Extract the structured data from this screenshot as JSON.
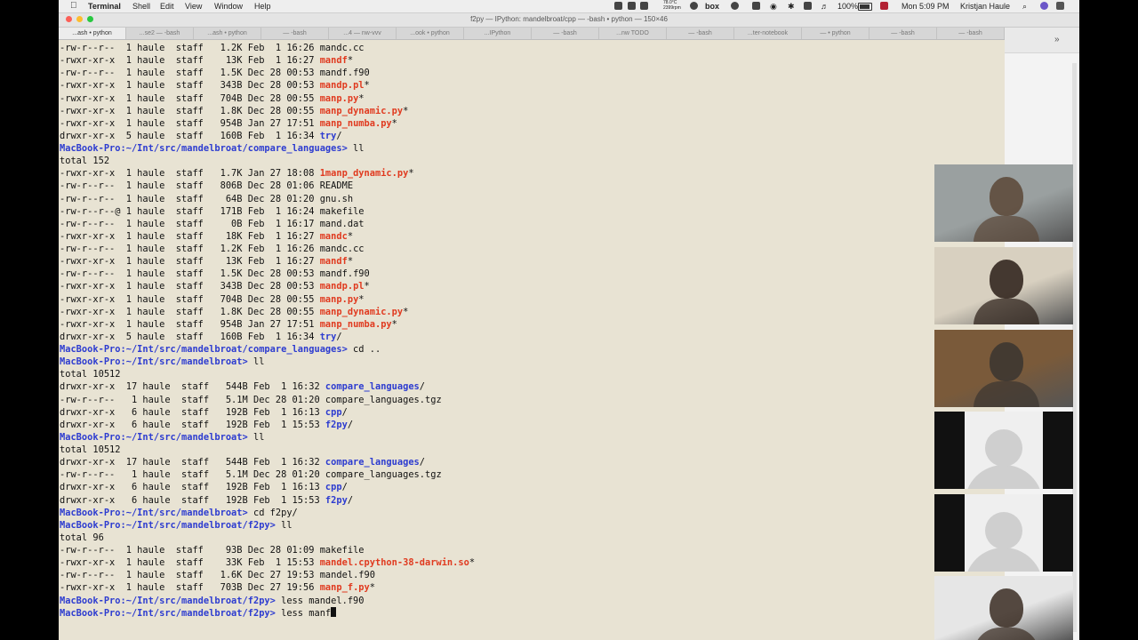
{
  "menubar": {
    "app_name": "Terminal",
    "menus": [
      "Shell",
      "Edit",
      "View",
      "Window",
      "Help"
    ],
    "status": {
      "temp": "78.0°C",
      "rpm": "2399rpm",
      "box_label": "box",
      "battery": "100%",
      "clock": "Mon 5:09 PM",
      "user": "Kristjan Haule"
    }
  },
  "window": {
    "title": "f2py — IPython: mandelbroat/cpp — -bash • python — 150×46",
    "tabs": [
      "...ash • python",
      "...se2 — -bash",
      "...ash • python",
      "— -bash",
      "...4 — nw-vvv",
      "...ook • python",
      "...IPython",
      "— -bash",
      "...nw TODO",
      "— -bash",
      "...ter-notebook",
      "— • python",
      "— -bash",
      "— -bash"
    ]
  },
  "terminal": {
    "lines": [
      [
        {
          "t": "-rw-r--r--  1 haule  staff   1.2K Feb  1 16:26 "
        },
        {
          "t": "mandc.cc"
        }
      ],
      [
        {
          "t": "-rwxr-xr-x  1 haule  staff    13K Feb  1 16:27 "
        },
        {
          "t": "mandf",
          "c": "exe"
        },
        {
          "t": "*"
        }
      ],
      [
        {
          "t": "-rw-r--r--  1 haule  staff   1.5K Dec 28 00:53 "
        },
        {
          "t": "mandf.f90"
        }
      ],
      [
        {
          "t": "-rwxr-xr-x  1 haule  staff   343B Dec 28 00:53 "
        },
        {
          "t": "mandp.pl",
          "c": "exe"
        },
        {
          "t": "*"
        }
      ],
      [
        {
          "t": "-rwxr-xr-x  1 haule  staff   704B Dec 28 00:55 "
        },
        {
          "t": "manp.py",
          "c": "exe"
        },
        {
          "t": "*"
        }
      ],
      [
        {
          "t": "-rwxr-xr-x  1 haule  staff   1.8K Dec 28 00:55 "
        },
        {
          "t": "manp_dynamic.py",
          "c": "exe"
        },
        {
          "t": "*"
        }
      ],
      [
        {
          "t": "-rwxr-xr-x  1 haule  staff   954B Jan 27 17:51 "
        },
        {
          "t": "manp_numba.py",
          "c": "exe"
        },
        {
          "t": "*"
        }
      ],
      [
        {
          "t": "drwxr-xr-x  5 haule  staff   160B Feb  1 16:34 "
        },
        {
          "t": "try",
          "c": "dir"
        },
        {
          "t": "/"
        }
      ],
      [
        {
          "t": "MacBook-Pro:~/Int/src/mandelbroat/compare_languages>",
          "c": "prompt"
        },
        {
          "t": " ll"
        }
      ],
      [
        {
          "t": "total 152"
        }
      ],
      [
        {
          "t": "-rwxr-xr-x  1 haule  staff   1.7K Jan 27 18:08 "
        },
        {
          "t": "1manp_dynamic.py",
          "c": "exe"
        },
        {
          "t": "*"
        }
      ],
      [
        {
          "t": "-rw-r--r--  1 haule  staff   806B Dec 28 01:06 "
        },
        {
          "t": "README"
        }
      ],
      [
        {
          "t": "-rw-r--r--  1 haule  staff    64B Dec 28 01:20 "
        },
        {
          "t": "gnu.sh"
        }
      ],
      [
        {
          "t": "-rw-r--r--@ 1 haule  staff   171B Feb  1 16:24 "
        },
        {
          "t": "makefile"
        }
      ],
      [
        {
          "t": "-rw-r--r--  1 haule  staff     0B Feb  1 16:17 "
        },
        {
          "t": "mand.dat"
        }
      ],
      [
        {
          "t": "-rwxr-xr-x  1 haule  staff    18K Feb  1 16:27 "
        },
        {
          "t": "mandc",
          "c": "exe"
        },
        {
          "t": "*"
        }
      ],
      [
        {
          "t": "-rw-r--r--  1 haule  staff   1.2K Feb  1 16:26 "
        },
        {
          "t": "mandc.cc"
        }
      ],
      [
        {
          "t": "-rwxr-xr-x  1 haule  staff    13K Feb  1 16:27 "
        },
        {
          "t": "mandf",
          "c": "exe"
        },
        {
          "t": "*"
        }
      ],
      [
        {
          "t": "-rw-r--r--  1 haule  staff   1.5K Dec 28 00:53 "
        },
        {
          "t": "mandf.f90"
        }
      ],
      [
        {
          "t": "-rwxr-xr-x  1 haule  staff   343B Dec 28 00:53 "
        },
        {
          "t": "mandp.pl",
          "c": "exe"
        },
        {
          "t": "*"
        }
      ],
      [
        {
          "t": "-rwxr-xr-x  1 haule  staff   704B Dec 28 00:55 "
        },
        {
          "t": "manp.py",
          "c": "exe"
        },
        {
          "t": "*"
        }
      ],
      [
        {
          "t": "-rwxr-xr-x  1 haule  staff   1.8K Dec 28 00:55 "
        },
        {
          "t": "manp_dynamic.py",
          "c": "exe"
        },
        {
          "t": "*"
        }
      ],
      [
        {
          "t": "-rwxr-xr-x  1 haule  staff   954B Jan 27 17:51 "
        },
        {
          "t": "manp_numba.py",
          "c": "exe"
        },
        {
          "t": "*"
        }
      ],
      [
        {
          "t": "drwxr-xr-x  5 haule  staff   160B Feb  1 16:34 "
        },
        {
          "t": "try",
          "c": "dir"
        },
        {
          "t": "/"
        }
      ],
      [
        {
          "t": "MacBook-Pro:~/Int/src/mandelbroat/compare_languages>",
          "c": "prompt"
        },
        {
          "t": " cd .."
        }
      ],
      [
        {
          "t": "MacBook-Pro:~/Int/src/mandelbroat>",
          "c": "prompt"
        },
        {
          "t": " ll"
        }
      ],
      [
        {
          "t": "total 10512"
        }
      ],
      [
        {
          "t": "drwxr-xr-x  17 haule  staff   544B Feb  1 16:32 "
        },
        {
          "t": "compare_languages",
          "c": "dir"
        },
        {
          "t": "/"
        }
      ],
      [
        {
          "t": "-rw-r--r--   1 haule  staff   5.1M Dec 28 01:20 "
        },
        {
          "t": "compare_languages.tgz"
        }
      ],
      [
        {
          "t": "drwxr-xr-x   6 haule  staff   192B Feb  1 16:13 "
        },
        {
          "t": "cpp",
          "c": "dir"
        },
        {
          "t": "/"
        }
      ],
      [
        {
          "t": "drwxr-xr-x   6 haule  staff   192B Feb  1 15:53 "
        },
        {
          "t": "f2py",
          "c": "dir"
        },
        {
          "t": "/"
        }
      ],
      [
        {
          "t": "MacBook-Pro:~/Int/src/mandelbroat>",
          "c": "prompt"
        },
        {
          "t": " ll"
        }
      ],
      [
        {
          "t": "total 10512"
        }
      ],
      [
        {
          "t": "drwxr-xr-x  17 haule  staff   544B Feb  1 16:32 "
        },
        {
          "t": "compare_languages",
          "c": "dir"
        },
        {
          "t": "/"
        }
      ],
      [
        {
          "t": "-rw-r--r--   1 haule  staff   5.1M Dec 28 01:20 "
        },
        {
          "t": "compare_languages.tgz"
        }
      ],
      [
        {
          "t": "drwxr-xr-x   6 haule  staff   192B Feb  1 16:13 "
        },
        {
          "t": "cpp",
          "c": "dir"
        },
        {
          "t": "/"
        }
      ],
      [
        {
          "t": "drwxr-xr-x   6 haule  staff   192B Feb  1 15:53 "
        },
        {
          "t": "f2py",
          "c": "dir"
        },
        {
          "t": "/"
        }
      ],
      [
        {
          "t": "MacBook-Pro:~/Int/src/mandelbroat>",
          "c": "prompt"
        },
        {
          "t": " cd f2py/"
        }
      ],
      [
        {
          "t": "MacBook-Pro:~/Int/src/mandelbroat/f2py>",
          "c": "prompt"
        },
        {
          "t": " ll"
        }
      ],
      [
        {
          "t": "total 96"
        }
      ],
      [
        {
          "t": "-rw-r--r--  1 haule  staff    93B Dec 28 01:09 "
        },
        {
          "t": "makefile"
        }
      ],
      [
        {
          "t": "-rwxr-xr-x  1 haule  staff    33K Feb  1 15:53 "
        },
        {
          "t": "mandel.cpython-38-darwin.so",
          "c": "exe"
        },
        {
          "t": "*"
        }
      ],
      [
        {
          "t": "-rw-r--r--  1 haule  staff   1.6K Dec 27 19:53 "
        },
        {
          "t": "mandel.f90"
        }
      ],
      [
        {
          "t": "-rwxr-xr-x  1 haule  staff   703B Dec 27 19:56 "
        },
        {
          "t": "manp_f.py",
          "c": "exe"
        },
        {
          "t": "*"
        }
      ],
      [
        {
          "t": "MacBook-Pro:~/Int/src/mandelbroat/f2py>",
          "c": "prompt"
        },
        {
          "t": " less mandel.f90"
        }
      ],
      [
        {
          "t": "MacBook-Pro:~/Int/src/mandelbroat/f2py>",
          "c": "prompt"
        },
        {
          "t": " less manf"
        },
        {
          "t": "",
          "c": "cursor"
        }
      ]
    ]
  },
  "video_tiles": [
    {
      "kind": "camera",
      "bg": "#9aa0a0",
      "fg": "#5a4636"
    },
    {
      "kind": "camera",
      "bg": "#d8d0c0",
      "fg": "#2a1d16"
    },
    {
      "kind": "camera",
      "bg": "#7a5a3a",
      "fg": "#3a3530"
    },
    {
      "kind": "avatar"
    },
    {
      "kind": "avatar"
    },
    {
      "kind": "camera",
      "bg": "#e6e6e6",
      "fg": "#3a2c22"
    }
  ],
  "colors": {
    "terminal_bg": "#e8e3d3",
    "prompt": "#2d3cd0",
    "executable": "#e03a1f",
    "directory": "#2d3cd0"
  }
}
